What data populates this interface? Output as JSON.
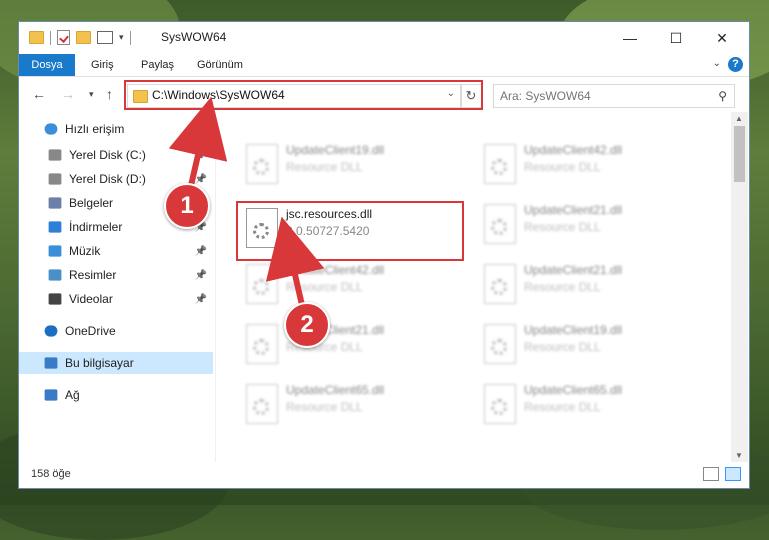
{
  "window": {
    "title": "SysWOW64",
    "minimize": "—",
    "maximize": "☐",
    "close": "✕"
  },
  "ribbon": {
    "tabs": [
      "Dosya",
      "Giriş",
      "Paylaş",
      "Görünüm"
    ],
    "help": "?"
  },
  "nav": {
    "address": "C:\\Windows\\SysWOW64",
    "search_placeholder": "Ara: SysWOW64"
  },
  "sidebar": {
    "items": [
      {
        "label": "Hızlı erişim",
        "icon": "star-icon"
      },
      {
        "label": "Yerel Disk (C:)",
        "icon": "drive-icon",
        "pinned": true
      },
      {
        "label": "Yerel Disk (D:)",
        "icon": "drive-icon",
        "pinned": true
      },
      {
        "label": "Belgeler",
        "icon": "documents-icon",
        "pinned": true
      },
      {
        "label": "İndirmeler",
        "icon": "downloads-icon",
        "pinned": true
      },
      {
        "label": "Müzik",
        "icon": "music-icon",
        "pinned": true
      },
      {
        "label": "Resimler",
        "icon": "pictures-icon",
        "pinned": true
      },
      {
        "label": "Videolar",
        "icon": "videos-icon",
        "pinned": true
      },
      {
        "label": "OneDrive",
        "icon": "onedrive-icon"
      },
      {
        "label": "Bu bilgisayar",
        "icon": "computer-icon",
        "selected": true
      },
      {
        "label": "Ağ",
        "icon": "network-icon"
      }
    ]
  },
  "files": {
    "highlighted": {
      "name": "jsc.resources.dll",
      "sub": "8.0.50727.5420"
    },
    "blurred": [
      {
        "name": "UpdateClient19.dll",
        "sub": "Resource DLL"
      },
      {
        "name": "UpdateClient42.dll",
        "sub": "Resource DLL"
      },
      {
        "name": "UpdateClient21.dll",
        "sub": "Resource DLL"
      },
      {
        "name": "UpdateClient42.dll",
        "sub": "Resource DLL"
      },
      {
        "name": "UpdateClient21.dll",
        "sub": "Resource DLL"
      },
      {
        "name": "UpdateClient21.dll",
        "sub": "Resource DLL"
      },
      {
        "name": "UpdateClient19.dll",
        "sub": "Resource DLL"
      },
      {
        "name": "UpdateClient65.dll",
        "sub": "Resource DLL"
      },
      {
        "name": "UpdateClient65.dll",
        "sub": "Resource DLL"
      }
    ]
  },
  "status": {
    "count": "158 öğe"
  },
  "annotations": {
    "step1": "1",
    "step2": "2"
  },
  "colors": {
    "accent": "#1979ca",
    "highlight": "#d9383a",
    "selected": "#cce8ff"
  }
}
